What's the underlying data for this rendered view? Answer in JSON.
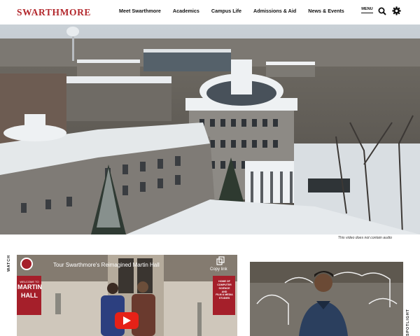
{
  "header": {
    "logo": "SWARTHMORE",
    "nav": [
      "Meet Swarthmore",
      "Academics",
      "Campus Life",
      "Admissions & Aid",
      "News & Events"
    ],
    "menu_label": "MENU"
  },
  "hero": {
    "caption": "This video does not contain audio"
  },
  "watch": {
    "label": "WATCH",
    "video_title": "Tour Swarthmore's Reimagined Martin Hall",
    "copy_link": "Copy link",
    "banner_left": [
      "WELCOME TO",
      "MARTIN",
      "HALL"
    ],
    "banner_right": [
      "HOME OF",
      "COMPUTER SCIENCE",
      "AND",
      "FILM & MEDIA",
      "STUDIES"
    ]
  },
  "spotlight": {
    "label": "SPOTLIGHT"
  },
  "colors": {
    "brand": "#b3282d",
    "youtube": "#e62117"
  }
}
